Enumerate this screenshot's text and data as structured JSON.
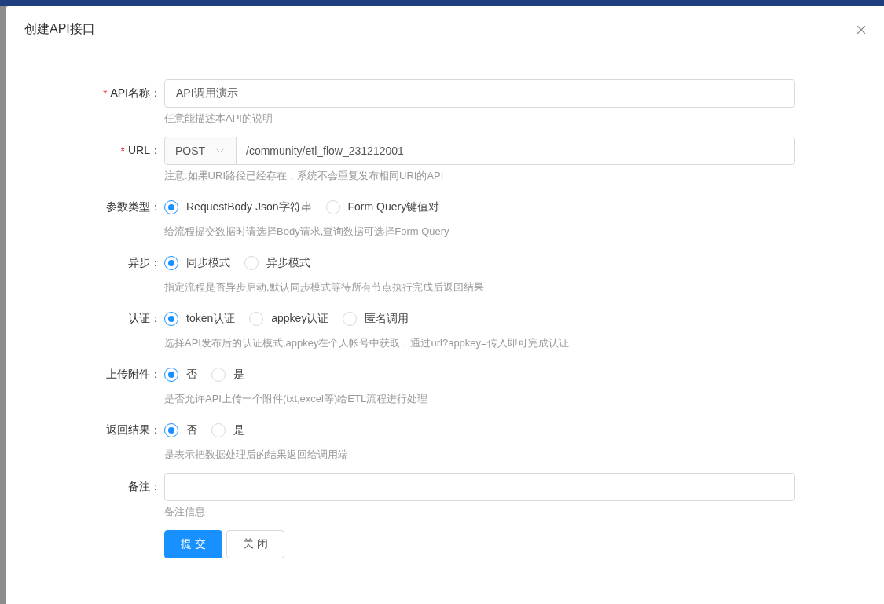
{
  "dialog": {
    "title": "创建API接口"
  },
  "fields": [
    {
      "kind": "input",
      "required_mark": "*",
      "label": "API名称：",
      "value": "API调用演示",
      "help": "任意能描述本API的说明"
    },
    {
      "kind": "url",
      "required_mark": "*",
      "label": "URL：",
      "method": "POST",
      "value": "/community/etl_flow_231212001",
      "help": "注意:如果URI路径已经存在，系统不会重复发布相同URI的API"
    },
    {
      "kind": "radio",
      "label": "参数类型：",
      "options": [
        {
          "label": "RequestBody Json字符串",
          "selected": true
        },
        {
          "label": "Form Query键值对",
          "selected": false
        }
      ],
      "help": "给流程提交数据时请选择Body请求,查询数据可选择Form Query"
    },
    {
      "kind": "radio",
      "label": "异步：",
      "options": [
        {
          "label": "同步模式",
          "selected": true
        },
        {
          "label": "异步模式",
          "selected": false
        }
      ],
      "help": "指定流程是否异步启动,默认同步模式等待所有节点执行完成后返回结果"
    },
    {
      "kind": "radio",
      "label": "认证：",
      "options": [
        {
          "label": "token认证",
          "selected": true
        },
        {
          "label": "appkey认证",
          "selected": false
        },
        {
          "label": "匿名调用",
          "selected": false
        }
      ],
      "help": "选择API发布后的认证模式,appkey在个人帐号中获取，通过url?appkey=传入即可完成认证"
    },
    {
      "kind": "radio",
      "label": "上传附件：",
      "options": [
        {
          "label": "否",
          "selected": true
        },
        {
          "label": "是",
          "selected": false
        }
      ],
      "help": "是否允许API上传一个附件(txt,excel等)给ETL流程进行处理"
    },
    {
      "kind": "radio",
      "label": "返回结果：",
      "options": [
        {
          "label": "否",
          "selected": true
        },
        {
          "label": "是",
          "selected": false
        }
      ],
      "help": "是表示把数据处理后的结果返回给调用端"
    },
    {
      "kind": "input",
      "label": "备注：",
      "help": "备注信息"
    }
  ],
  "buttons": [
    {
      "label": "提交",
      "kind": "primary"
    },
    {
      "label": "关闭",
      "kind": "default"
    }
  ]
}
